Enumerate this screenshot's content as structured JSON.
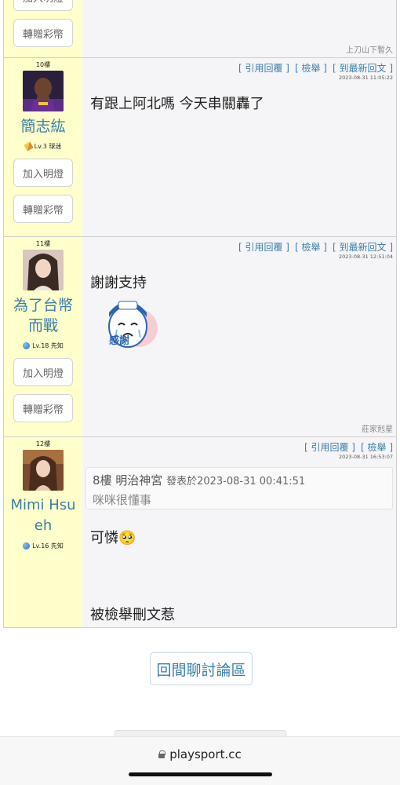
{
  "post_actions": {
    "quote": "引用回覆",
    "report": "檢舉",
    "latest": "到最新回文"
  },
  "user_buttons": {
    "light": "加入明燈",
    "gift": "轉贈彩幣"
  },
  "top_partial": {
    "signature": "上刀山下暫久"
  },
  "posts": [
    {
      "floor": "10樓",
      "username": "簡志紘",
      "level": "Lv.3 球迷",
      "timestamp": "2023-08-31 11:05:22",
      "body": "有跟上阿北嗎 今天串關轟了"
    },
    {
      "floor": "11樓",
      "username": "為了台幣而戰",
      "level": "Lv.18 先知",
      "timestamp": "2023-08-31 12:51:04",
      "body": "謝謝支持",
      "sticker_text": "感謝",
      "signature": "莊家剋星"
    },
    {
      "floor": "12樓",
      "username": "Mimi Hsueh",
      "level": "Lv.16 先知",
      "timestamp": "2023-08-31 16:53:07",
      "quote": {
        "head": "8樓 明治神宮",
        "meta": "發表於2023-08-31 00:41:51",
        "text": "咪咪很懂事"
      },
      "body": "可憐🥺",
      "note": "被檢舉刪文惹"
    }
  ],
  "back_button": "回間聊討論區",
  "browser": {
    "url": "playsport.cc"
  }
}
